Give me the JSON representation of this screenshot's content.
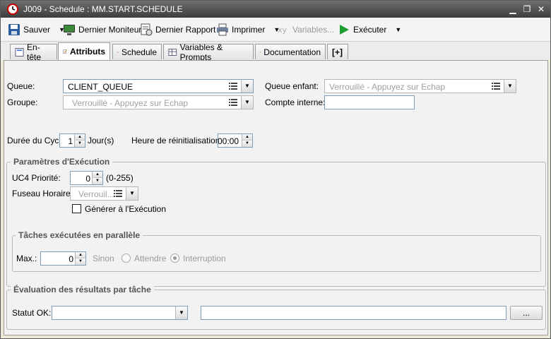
{
  "window": {
    "title": "J009 - Schedule : MM.START.SCHEDULE"
  },
  "toolbar": {
    "save": "Sauver",
    "last_monitor": "Dernier Moniteur",
    "last_report": "Dernier Rapport",
    "print": "Imprimer",
    "variables": "Variables...",
    "execute": "Exécuter"
  },
  "tabs": [
    "En-tête",
    "Attributs",
    "Schedule",
    "Variables & Prompts",
    "Documentation",
    "[+]"
  ],
  "attributes": {
    "queue_label": "Queue:",
    "queue_value": "CLIENT_QUEUE",
    "child_queue_label": "Queue enfant:",
    "child_queue_placeholder": "Verrouillé - Appuyez sur Echap",
    "group_label": "Groupe:",
    "group_placeholder": "Verrouillé - Appuyez sur Echap",
    "internal_account_label": "Compte interne:",
    "internal_account_value": "",
    "cycle_label": "Durée du Cycle",
    "cycle_value": "1",
    "cycle_unit": "Jour(s)",
    "reset_label": "Heure de réinitialisation:",
    "reset_value": "00:00"
  },
  "execution": {
    "legend": "Paramètres d'Exécution",
    "priority_label": "UC4 Priorité:",
    "priority_value": "0",
    "priority_range": "(0-255)",
    "timezone_label": "Fuseau Horaire:",
    "timezone_placeholder": "Verrouil...",
    "generate_label": "Générer à l'Exécution",
    "generate_checked": false
  },
  "parallel": {
    "legend": "Tâches exécutées en parallèle",
    "max_label": "Max.:",
    "max_value": "0",
    "else_label": "Sinon",
    "wait_label": "Attendre",
    "interrupt_label": "Interruption",
    "selected": "Interruption"
  },
  "evaluation": {
    "legend": "Évaluation des résultats par tâche",
    "status_label": "Statut OK:",
    "status_value": "",
    "text_value": "",
    "browse_label": "..."
  }
}
